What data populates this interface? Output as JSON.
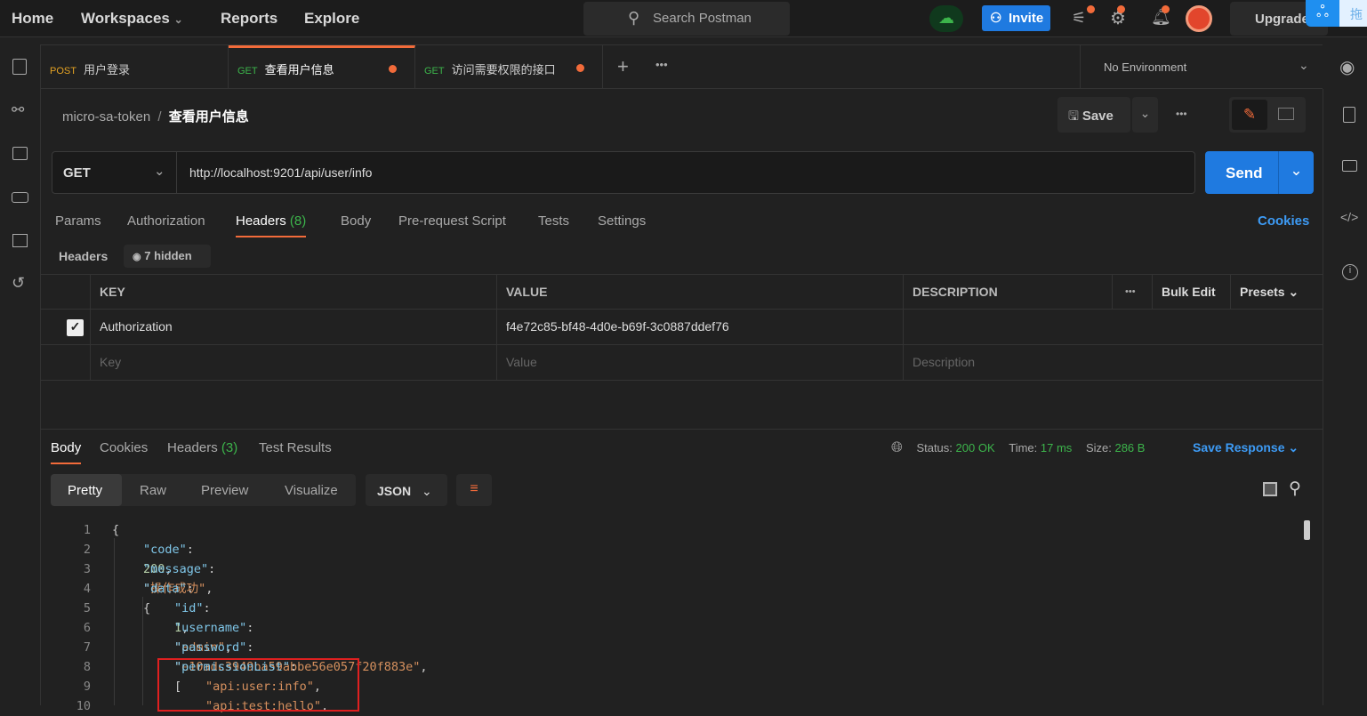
{
  "topbar": {
    "nav": [
      "Home",
      "Workspaces",
      "Reports",
      "Explore"
    ],
    "search_placeholder": "Search Postman",
    "invite": "Invite",
    "upgrade": "Upgrade",
    "badge_text": "拖"
  },
  "tabs": [
    {
      "method": "POST",
      "name": "用户登录",
      "method_color": "#e5a323",
      "unsaved": false
    },
    {
      "method": "GET",
      "name": "查看用户信息",
      "method_color": "#3cb44b",
      "unsaved": true,
      "active": true
    },
    {
      "method": "GET",
      "name": "访问需要权限的接口",
      "method_color": "#3cb44b",
      "unsaved": true
    }
  ],
  "environment": "No Environment",
  "breadcrumb": {
    "collection": "micro-sa-token",
    "sep": "/",
    "request": "查看用户信息"
  },
  "save": "Save",
  "request": {
    "method": "GET",
    "url": "http://localhost:9201/api/user/info",
    "send": "Send"
  },
  "req_tabs": [
    "Params",
    "Authorization",
    "Headers",
    "Body",
    "Pre-request Script",
    "Tests",
    "Settings"
  ],
  "headers_count": "(8)",
  "cookies": "Cookies",
  "headers_label": "Headers",
  "hidden": "7 hidden",
  "table": {
    "cols": [
      "KEY",
      "VALUE",
      "DESCRIPTION"
    ],
    "bulk": "Bulk Edit",
    "presets": "Presets",
    "rows": [
      {
        "checked": true,
        "key": "Authorization",
        "value": "f4e72c85-bf48-4d0e-b69f-3c0887ddef76",
        "description": ""
      }
    ],
    "placeholder": {
      "key": "Key",
      "value": "Value",
      "description": "Description"
    }
  },
  "response": {
    "tabs": [
      "Body",
      "Cookies",
      "Headers",
      "Test Results"
    ],
    "headers_count": "(3)",
    "status_label": "Status:",
    "status": "200 OK",
    "time_label": "Time:",
    "time": "17 ms",
    "size_label": "Size:",
    "size": "286 B",
    "save_response": "Save Response",
    "views": [
      "Pretty",
      "Raw",
      "Preview",
      "Visualize"
    ],
    "format": "JSON"
  },
  "code_lines": [
    [
      [
        "p",
        "{"
      ]
    ],
    [
      [
        "k",
        "\"code\""
      ],
      [
        "p",
        ": "
      ],
      [
        "n",
        "200"
      ],
      [
        "p",
        ","
      ]
    ],
    [
      [
        "k",
        "\"message\""
      ],
      [
        "p",
        ": "
      ],
      [
        "s",
        "\"操作成功\""
      ],
      [
        "p",
        ","
      ]
    ],
    [
      [
        "k",
        "\"data\""
      ],
      [
        "p",
        ": {"
      ]
    ],
    [
      [
        "k",
        "\"id\""
      ],
      [
        "p",
        ": "
      ],
      [
        "n",
        "1"
      ],
      [
        "p",
        ","
      ]
    ],
    [
      [
        "k",
        "\"username\""
      ],
      [
        "p",
        ": "
      ],
      [
        "s",
        "\"admin\""
      ],
      [
        "p",
        ","
      ]
    ],
    [
      [
        "k",
        "\"password\""
      ],
      [
        "p",
        ": "
      ],
      [
        "s",
        "\"e10adc3949ba59abbe56e057f20f883e\""
      ],
      [
        "p",
        ","
      ]
    ],
    [
      [
        "k",
        "\"permissionList\""
      ],
      [
        "p",
        ": ["
      ]
    ],
    [
      [
        "s",
        "\"api:user:info\""
      ],
      [
        "p",
        ","
      ]
    ],
    [
      [
        "s",
        "\"api:test:hello\""
      ],
      [
        "p",
        ","
      ]
    ]
  ],
  "code_indent": [
    0,
    1,
    1,
    1,
    2,
    2,
    2,
    2,
    3,
    3
  ],
  "colors": {
    "accent": "#f26b3a",
    "blue": "#1f7ae0",
    "ok": "#3cb44b",
    "highlight_box": "#e02020"
  }
}
